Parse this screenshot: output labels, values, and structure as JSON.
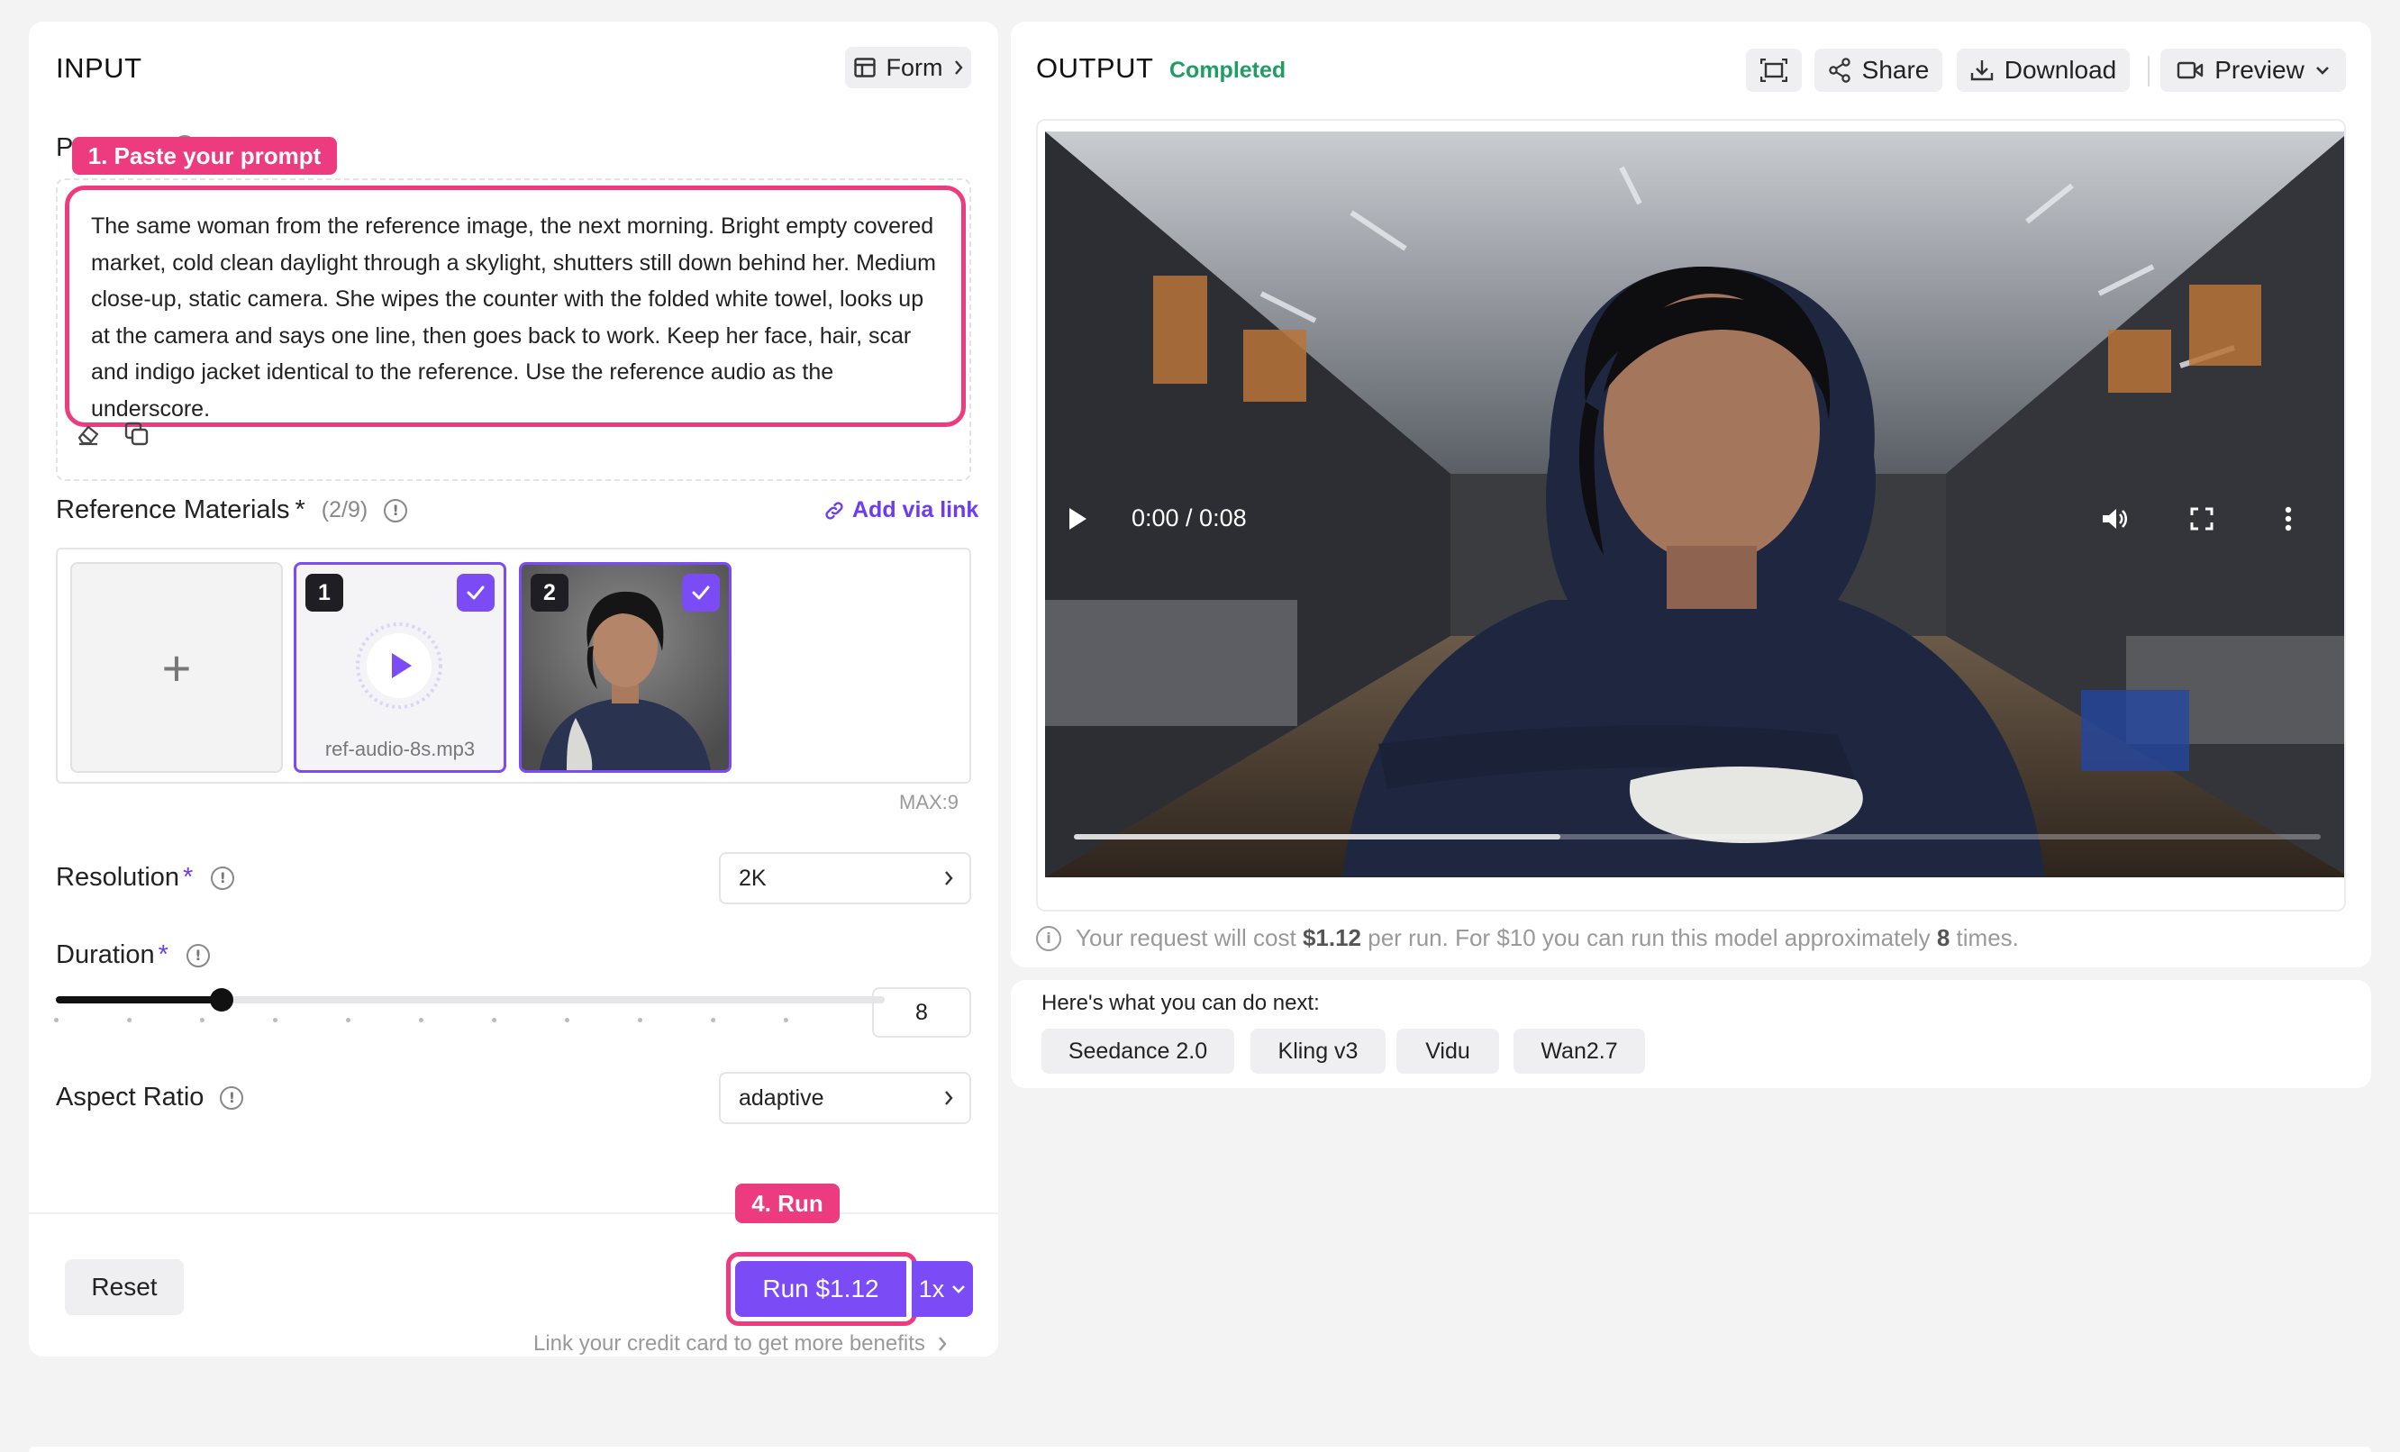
{
  "input": {
    "title": "INPUT",
    "form_button": "Form",
    "prompt_label_partial": "P",
    "callout_prompt": "1. Paste your prompt",
    "prompt_text": "The same woman from the reference image, the next morning. Bright empty covered market, cold clean daylight through a skylight, shutters still down behind her. Medium close-up, static camera. She wipes the counter with the folded white towel, looks up at the camera and says one line, then goes back to work. Keep her face, hair, scar and indigo jacket identical to the reference. Use the reference audio as the underscore.",
    "reference": {
      "label": "Reference Materials",
      "required_mark": "*",
      "count": "(2/9)",
      "add_link": "Add via link",
      "max_label": "MAX:9",
      "items": [
        {
          "index": "1",
          "file_name": "ref-audio-8s.mp3",
          "kind": "audio"
        },
        {
          "index": "2",
          "kind": "image"
        }
      ]
    },
    "resolution": {
      "label": "Resolution",
      "required_mark": "*",
      "value": "2K"
    },
    "duration": {
      "label": "Duration",
      "required_mark": "*",
      "value": "8",
      "slider_fraction": 0.2
    },
    "aspect_ratio": {
      "label": "Aspect Ratio",
      "value": "adaptive"
    },
    "callout_run": "4. Run",
    "reset_label": "Reset",
    "run_label": "Run $1.12",
    "multiplier": "1x",
    "credit_link": "Link your credit card to get more benefits"
  },
  "output": {
    "title": "OUTPUT",
    "status": "Completed",
    "share_label": "Share",
    "download_label": "Download",
    "preview_label": "Preview",
    "video": {
      "time": "0:00 / 0:08",
      "progress": 0.39
    },
    "cost_note": {
      "prefix": "Your request will cost",
      "price": "$1.12",
      "middle": "per run. For $10 you can run this model approximately",
      "times": "8",
      "suffix": "times."
    }
  },
  "next": {
    "title": "Here's what you can do next:",
    "models": [
      "Seedance 2.0",
      "Kling v3",
      "Vidu",
      "Wan2.7"
    ]
  },
  "colors": {
    "accent": "#7b4cf5",
    "callout": "#ec3b7e",
    "status": "#1f9e63"
  }
}
